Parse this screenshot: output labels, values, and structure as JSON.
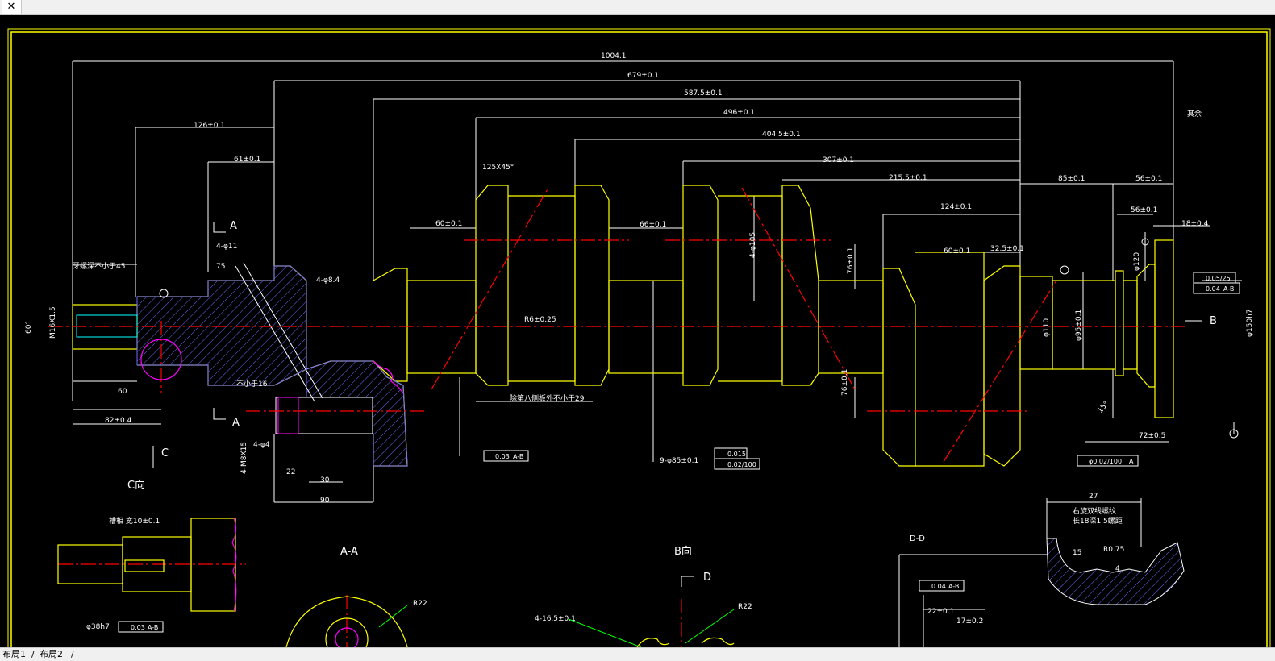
{
  "window": {
    "close_glyph": "✕"
  },
  "layout_tabs": [
    "布局1",
    "布局2"
  ],
  "colors": {
    "background": "#000000",
    "outline": "#ffff00",
    "dimension": "#ffffff",
    "centerline": "#ff0000",
    "hatch": "#6c6cff",
    "section_edge": "#ff00ff",
    "dim_line": "#00ff00"
  },
  "dimensions": {
    "overall": "1004.1",
    "d679": "679±0.1",
    "d587": "587.5±0.1",
    "d496": "496±0.1",
    "d404": "404.5±0.1",
    "d307": "307±0.1",
    "d215": "215.5±0.1",
    "d126": "126±0.1",
    "d61": "61±0.1",
    "d85": "85±0.1",
    "d56a": "56±0.1",
    "d56b": "56±0.1",
    "d18": "18±0.4",
    "d124": "124±0.1",
    "d60a": "60±0.1",
    "d66": "66±0.1",
    "d60b": "60±0.1",
    "d32": "32.5±0.1",
    "chamfer": "125X45°",
    "thread_depth": "牙螺深不小于45",
    "holes_11": "4-φ11",
    "holes_84": "4-φ8.4",
    "d75": "75",
    "not_less16": "不小于16",
    "holes_4": "4-φ4",
    "thread": "4-M8X15",
    "d22": "22",
    "d30": "30",
    "d90": "90",
    "d60c": "60",
    "d82": "82±0.4",
    "r6": "R6±0.25",
    "d_105": "4-φ105",
    "d76a": "76±0.1",
    "d76b": "76±0.1",
    "d110": "φ110",
    "d95": "φ95±0.1",
    "d120": "φ120",
    "d150": "φ150h7",
    "d72": "72±0.5",
    "d15": "15°",
    "d60deg": "60°",
    "m16": "M16X1.5",
    "side_note": "除第八侧板外不小于29",
    "journals": "9-φ85±0.1",
    "view_c": "C",
    "view_c_label": "C向",
    "section_a1": "A",
    "section_a2": "A",
    "section_aa": "A-A",
    "view_b_label": "B向",
    "view_b": "B",
    "view_d": "D",
    "section_dd": "D-D",
    "r22a": "R22",
    "r22b": "R22",
    "holes_16": "4-16.5±0.1",
    "d38": "φ38h7",
    "groove": "槽相 宽10±0.1",
    "other": "其余",
    "thread_note1": "右旋双线螺纹",
    "thread_note2": "长18深1.5螺距",
    "d27": "27",
    "d15b": "15",
    "r075": "R0.75",
    "d4": "4",
    "d22b": "22±0.1",
    "d17": "17±0.2"
  },
  "tolerances": {
    "runout_ab": {
      "value": "0.03",
      "datum": "A-B"
    },
    "circularity": "0.015",
    "parallel": "0.02/100",
    "concentric": {
      "value": "φ0.02/100",
      "datum": "A"
    },
    "flatness_right": "0.05/25",
    "runout_right": {
      "value": "0.04",
      "datum": "A-B"
    },
    "runout_left": {
      "value": "0.03",
      "datum": "A-B"
    },
    "runout_d": {
      "value": "0.04",
      "datum": "A-B"
    }
  }
}
